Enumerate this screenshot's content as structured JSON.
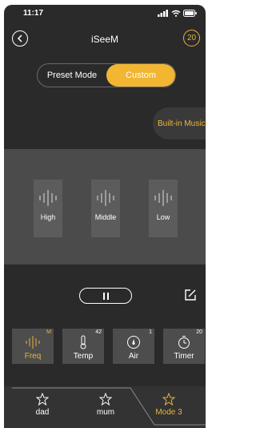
{
  "status_bar": {
    "time": "11:17"
  },
  "nav": {
    "title": "iSeeM",
    "count": "20"
  },
  "mode_toggle": {
    "preset_label": "Preset Mode",
    "custom_label": "Custom",
    "selected": "Custom"
  },
  "builtin_music": {
    "label": "Built-in Music"
  },
  "equalizer": {
    "bands": [
      {
        "label": "High",
        "icon": "waveform-icon"
      },
      {
        "label": "Middle",
        "icon": "waveform-icon"
      },
      {
        "label": "Low",
        "icon": "waveform-icon"
      }
    ]
  },
  "controls": {
    "pause_icon": "pause-icon",
    "edit_icon": "edit-icon"
  },
  "features": [
    {
      "label": "Freq",
      "sup": "M",
      "icon": "waveform-icon",
      "active": true
    },
    {
      "label": "Temp",
      "sup": "42",
      "icon": "thermometer-icon",
      "active": false
    },
    {
      "label": "Air",
      "sup": "1",
      "icon": "gauge-icon",
      "active": false
    },
    {
      "label": "Timer",
      "sup": "20",
      "icon": "timer-icon",
      "active": false
    }
  ],
  "tabs": [
    {
      "label": "dad",
      "icon": "star-icon",
      "active": false
    },
    {
      "label": "mum",
      "icon": "star-icon",
      "active": false
    },
    {
      "label": "Mode 3",
      "icon": "star-icon",
      "active": true
    }
  ],
  "colors": {
    "accent": "#f2b632",
    "background": "#2a2a2a",
    "panel": "#4b4b4b"
  }
}
